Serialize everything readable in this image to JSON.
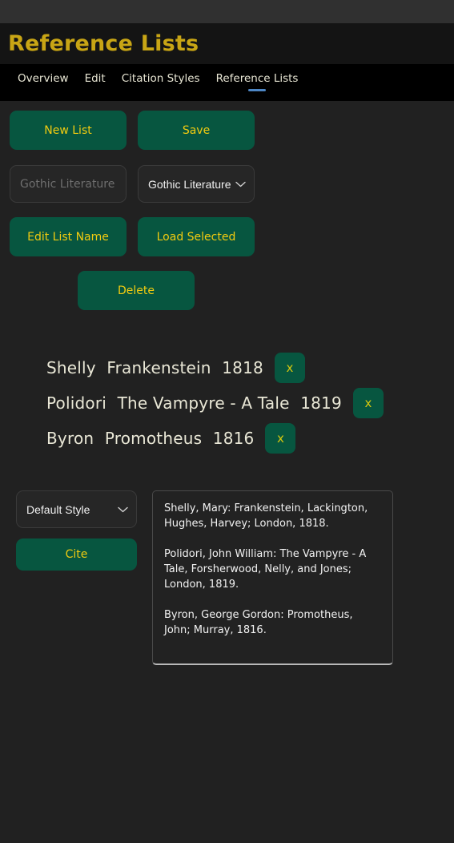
{
  "window": {
    "chrome_strip": "",
    "title": "Reference Lists",
    "title_color": "#c8a515",
    "background": "#212121",
    "accent_green": "#075640",
    "accent_gold": "#f2cb10",
    "tab_underline_color": "#4d86c4"
  },
  "tabs": [
    {
      "label": "Overview",
      "active": false
    },
    {
      "label": "Edit",
      "active": false
    },
    {
      "label": "Citation Styles",
      "active": false
    },
    {
      "label": "Reference Lists",
      "active": true
    }
  ],
  "toolbar": {
    "new_list_label": "New List",
    "save_label": "Save",
    "edit_list_name_label": "Edit List Name",
    "load_selected_label": "Load Selected",
    "delete_label": "Delete"
  },
  "list_name_input": {
    "value": "",
    "placeholder": "Gothic Literature"
  },
  "list_select": {
    "selected": "Gothic Literature",
    "chevron": "chevron-down-icon",
    "options": [
      "Gothic Literature"
    ]
  },
  "references": [
    {
      "author": "Shelly",
      "title": "Frankenstein",
      "year": "1818",
      "remove_label": "x"
    },
    {
      "author": "Polidori",
      "title": "The Vampyre - A Tale",
      "year": "1819",
      "remove_label": "x"
    },
    {
      "author": "Byron",
      "title": "Promotheus",
      "year": "1816",
      "remove_label": "x"
    }
  ],
  "cite": {
    "style_select": {
      "selected": "Default Style",
      "chevron": "chevron-down-icon",
      "options": [
        "Default Style"
      ]
    },
    "cite_button_label": "Cite",
    "output": [
      "Shelly, Mary: Frankenstein, Lackington, Hughes, Harvey; London, 1818.",
      "Polidori, John William: The Vampyre - A Tale, Forsherwood, Nelly, and Jones; London, 1819.",
      "Byron, George Gordon: Promotheus, John; Murray, 1816."
    ]
  }
}
